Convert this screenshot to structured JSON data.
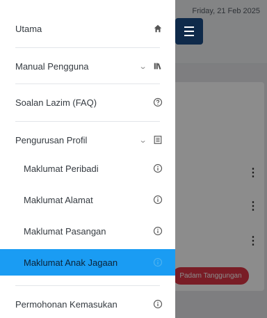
{
  "header": {
    "date": "Friday, 21 Feb 2025"
  },
  "menu_button": {
    "icon": "hamburger-icon"
  },
  "background_actions": {
    "danger_button": "Padam Tanggungan"
  },
  "sidebar": {
    "items": [
      {
        "label": "Utama",
        "icon": "home-icon"
      },
      {
        "label": "Manual Pengguna",
        "icon": "books-icon",
        "expandable": true
      },
      {
        "label": "Soalan Lazim (FAQ)",
        "icon": "question-circle-icon"
      },
      {
        "label": "Pengurusan Profil",
        "icon": "document-list-icon",
        "expandable": true
      },
      {
        "label": "Maklumat Peribadi",
        "icon": "info-circle-icon"
      },
      {
        "label": "Maklumat Alamat",
        "icon": "info-circle-icon"
      },
      {
        "label": "Maklumat Pasangan",
        "icon": "info-circle-icon"
      },
      {
        "label": "Maklumat Anak Jagaan",
        "icon": "info-circle-icon",
        "active": true
      },
      {
        "label": "Permohonan Kemasukan",
        "icon": "info-circle-icon"
      }
    ]
  },
  "colors": {
    "active_bg": "#1a9cf3",
    "menu_button_bg": "#0f2a4a",
    "danger": "#dc3545"
  }
}
